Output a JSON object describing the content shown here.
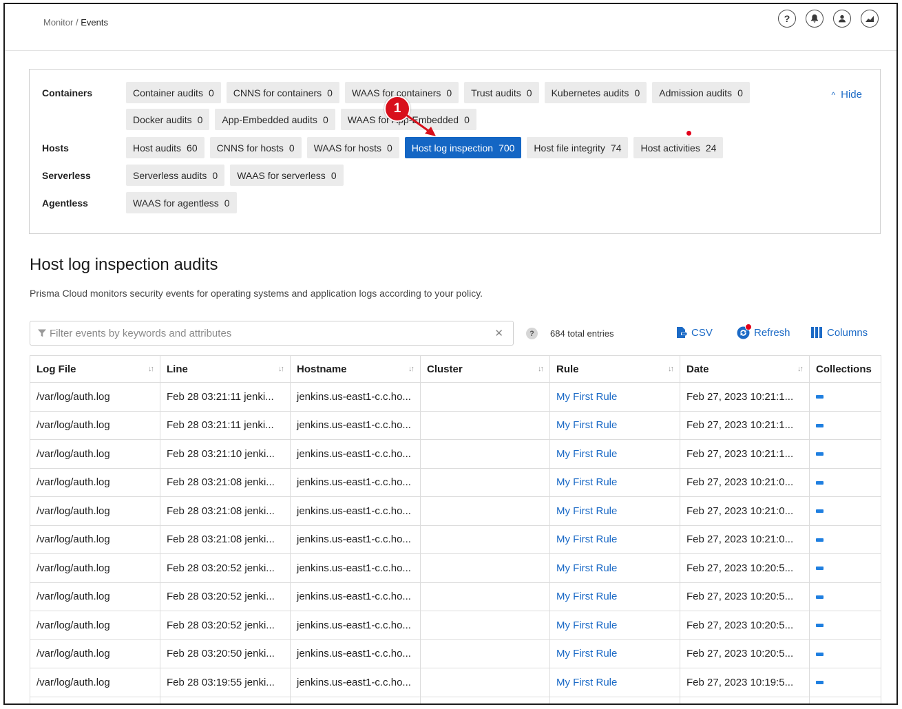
{
  "breadcrumb": {
    "parent": "Monitor",
    "separator": " / ",
    "current": "Events"
  },
  "header_icons": [
    "help-icon",
    "notification-bell-icon",
    "user-account-icon",
    "analytics-icon"
  ],
  "help_icon_glyph": "?",
  "filters": {
    "hide_label": "Hide",
    "categories": [
      {
        "label": "Containers",
        "chips": [
          {
            "label": "Container audits",
            "count": "0"
          },
          {
            "label": "CNNS for containers",
            "count": "0"
          },
          {
            "label": "WAAS for containers",
            "count": "0"
          },
          {
            "label": "Trust audits",
            "count": "0"
          },
          {
            "label": "Kubernetes audits",
            "count": "0"
          },
          {
            "label": "Admission audits",
            "count": "0"
          },
          {
            "label": "Docker audits",
            "count": "0"
          },
          {
            "label": "App-Embedded audits",
            "count": "0"
          },
          {
            "label": "WAAS for App-Embedded",
            "count": "0"
          }
        ]
      },
      {
        "label": "Hosts",
        "chips": [
          {
            "label": "Host audits",
            "count": "60"
          },
          {
            "label": "CNNS for hosts",
            "count": "0"
          },
          {
            "label": "WAAS for hosts",
            "count": "0"
          },
          {
            "label": "Host log inspection",
            "count": "700",
            "active": true
          },
          {
            "label": "Host file integrity",
            "count": "74"
          },
          {
            "label": "Host activities",
            "count": "24"
          }
        ]
      },
      {
        "label": "Serverless",
        "chips": [
          {
            "label": "Serverless audits",
            "count": "0"
          },
          {
            "label": "WAAS for serverless",
            "count": "0"
          }
        ]
      },
      {
        "label": "Agentless",
        "chips": [
          {
            "label": "WAAS for agentless",
            "count": "0"
          }
        ]
      }
    ]
  },
  "annotation": {
    "number": "1"
  },
  "page": {
    "title": "Host log inspection audits",
    "description": "Prisma Cloud monitors security events for operating systems and application logs according to your policy."
  },
  "search": {
    "placeholder": "Filter events by keywords and attributes",
    "value": ""
  },
  "total_entries": "684 total entries",
  "toolbar": {
    "csv_label": "CSV",
    "refresh_label": "Refresh",
    "columns_label": "Columns"
  },
  "table": {
    "columns": [
      "Log File",
      "Line",
      "Hostname",
      "Cluster",
      "Rule",
      "Date",
      "Collections"
    ],
    "rows": [
      [
        "/var/log/auth.log",
        "Feb 28 03:21:11 jenki...",
        "jenkins.us-east1-c.c.ho...",
        "",
        "My First Rule",
        "Feb 27, 2023 10:21:1..."
      ],
      [
        "/var/log/auth.log",
        "Feb 28 03:21:11 jenki...",
        "jenkins.us-east1-c.c.ho...",
        "",
        "My First Rule",
        "Feb 27, 2023 10:21:1..."
      ],
      [
        "/var/log/auth.log",
        "Feb 28 03:21:10 jenki...",
        "jenkins.us-east1-c.c.ho...",
        "",
        "My First Rule",
        "Feb 27, 2023 10:21:1..."
      ],
      [
        "/var/log/auth.log",
        "Feb 28 03:21:08 jenki...",
        "jenkins.us-east1-c.c.ho...",
        "",
        "My First Rule",
        "Feb 27, 2023 10:21:0..."
      ],
      [
        "/var/log/auth.log",
        "Feb 28 03:21:08 jenki...",
        "jenkins.us-east1-c.c.ho...",
        "",
        "My First Rule",
        "Feb 27, 2023 10:21:0..."
      ],
      [
        "/var/log/auth.log",
        "Feb 28 03:21:08 jenki...",
        "jenkins.us-east1-c.c.ho...",
        "",
        "My First Rule",
        "Feb 27, 2023 10:21:0..."
      ],
      [
        "/var/log/auth.log",
        "Feb 28 03:20:52 jenki...",
        "jenkins.us-east1-c.c.ho...",
        "",
        "My First Rule",
        "Feb 27, 2023 10:20:5..."
      ],
      [
        "/var/log/auth.log",
        "Feb 28 03:20:52 jenki...",
        "jenkins.us-east1-c.c.ho...",
        "",
        "My First Rule",
        "Feb 27, 2023 10:20:5..."
      ],
      [
        "/var/log/auth.log",
        "Feb 28 03:20:52 jenki...",
        "jenkins.us-east1-c.c.ho...",
        "",
        "My First Rule",
        "Feb 27, 2023 10:20:5..."
      ],
      [
        "/var/log/auth.log",
        "Feb 28 03:20:50 jenki...",
        "jenkins.us-east1-c.c.ho...",
        "",
        "My First Rule",
        "Feb 27, 2023 10:20:5..."
      ],
      [
        "/var/log/auth.log",
        "Feb 28 03:19:55 jenki...",
        "jenkins.us-east1-c.c.ho...",
        "",
        "My First Rule",
        "Feb 27, 2023 10:19:5..."
      ],
      [
        "",
        "",
        "",
        "",
        "",
        ""
      ]
    ]
  },
  "colors": {
    "accent": "#1466c4",
    "link": "#1b6ac6",
    "alert": "#e2001a",
    "chip_bg": "#ebebeb"
  }
}
